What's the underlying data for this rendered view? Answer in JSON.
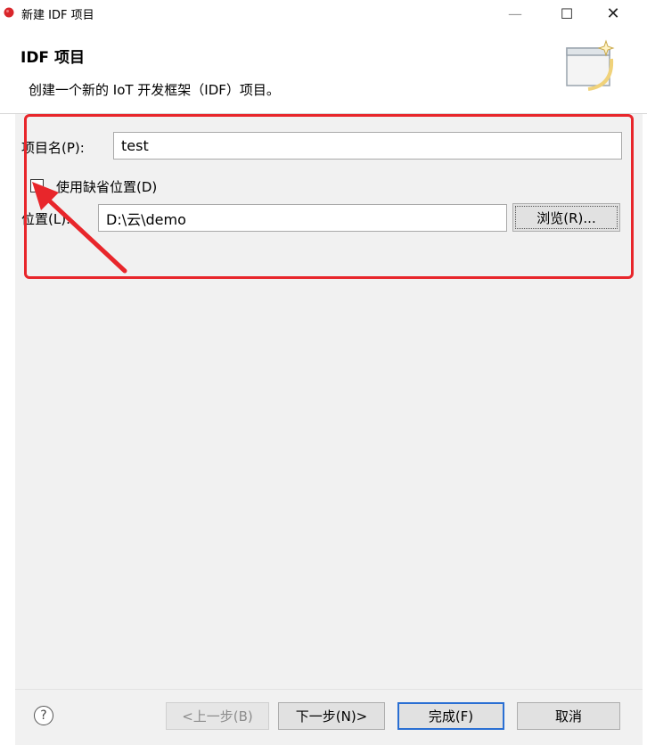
{
  "window": {
    "title": "新建 IDF 项目",
    "minimize_glyph": "—",
    "maximize_glyph": "☐",
    "close_glyph": "✕"
  },
  "header": {
    "title": "IDF 项目",
    "description": "创建一个新的 IoT 开发框架（IDF）项目。",
    "graphic_icon": "new-wizard-icon"
  },
  "form": {
    "project_name_label": "项目名(P):",
    "project_name_value": "test",
    "use_default_location_label": "使用缺省位置(D)",
    "use_default_location_checked": false,
    "location_label": "位置(L):",
    "location_value": "D:\\云\\demo",
    "browse_label": "浏览(R)..."
  },
  "footer": {
    "help_glyph": "?",
    "back_label": "<上一步(B)",
    "next_label": "下一步(N)>",
    "finish_label": "完成(F)",
    "cancel_label": "取消"
  },
  "annotation": {
    "color": "#e8262b"
  }
}
